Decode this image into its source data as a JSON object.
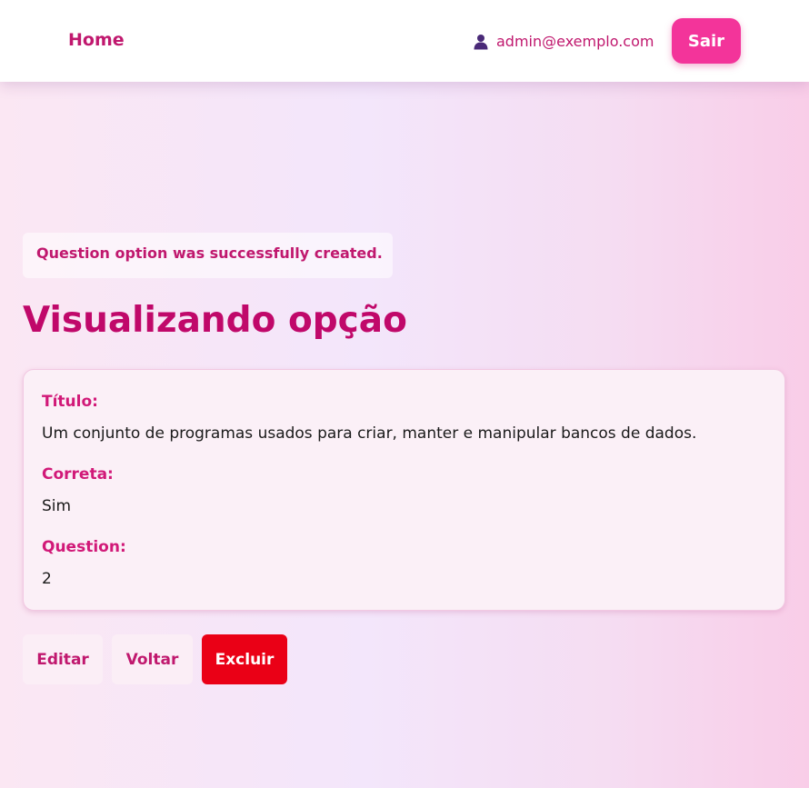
{
  "nav": {
    "home_label": "Home",
    "user_icon": "user-icon",
    "user_email": "admin@exemplo.com",
    "logout_label": "Sair"
  },
  "notice": {
    "text": "Question option was successfully created."
  },
  "page": {
    "title": "Visualizando opção"
  },
  "details": {
    "fields": [
      {
        "label": "Título:",
        "value": "Um conjunto de programas usados para criar, manter e manipular bancos de dados."
      },
      {
        "label": "Correta:",
        "value": "Sim"
      },
      {
        "label": "Question:",
        "value": "2"
      }
    ]
  },
  "actions": {
    "edit_label": "Editar",
    "back_label": "Voltar",
    "delete_label": "Excluir"
  },
  "colors": {
    "accent": "#c0186e",
    "logout_button": "#f3349a",
    "delete_button": "#ea0016",
    "user_icon": "#4a2a78"
  }
}
